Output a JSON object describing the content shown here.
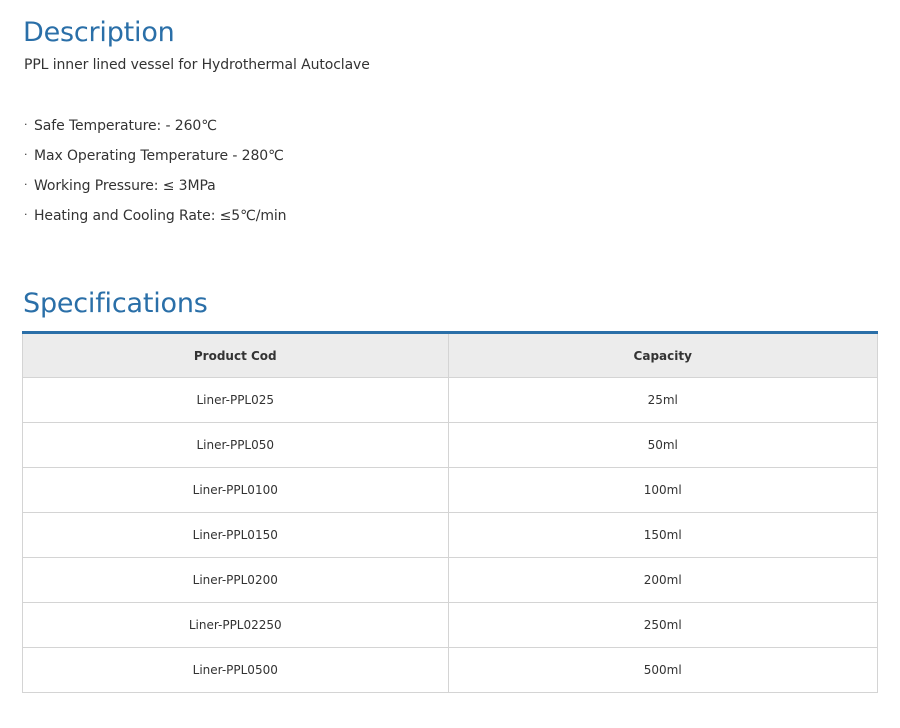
{
  "description": {
    "title": "Description",
    "subtitle": "PPL inner lined vessel for Hydrothermal Autoclave",
    "bullet_glyph": "·",
    "features": [
      "Safe Temperature: - 260℃",
      "Max Operating Temperature - 280℃",
      "Working Pressure: ≤ 3MPa",
      "Heating and Cooling Rate: ≤5℃/min"
    ]
  },
  "specifications": {
    "title": "Specifications",
    "headers": [
      "Product Cod",
      "Capacity"
    ],
    "rows": [
      [
        "Liner-PPL025",
        "25ml"
      ],
      [
        "Liner-PPL050",
        "50ml"
      ],
      [
        "Liner-PPL0100",
        "100ml"
      ],
      [
        "Liner-PPL0150",
        "150ml"
      ],
      [
        "Liner-PPL0200",
        "200ml"
      ],
      [
        "Liner-PPL02250",
        "250ml"
      ],
      [
        "Liner-PPL0500",
        "500ml"
      ]
    ]
  },
  "colors": {
    "heading": "#2a6fa8",
    "table_accent": "#2a6fa8",
    "header_bg": "#ececec",
    "border": "#d4d4d4",
    "text": "#333333"
  }
}
